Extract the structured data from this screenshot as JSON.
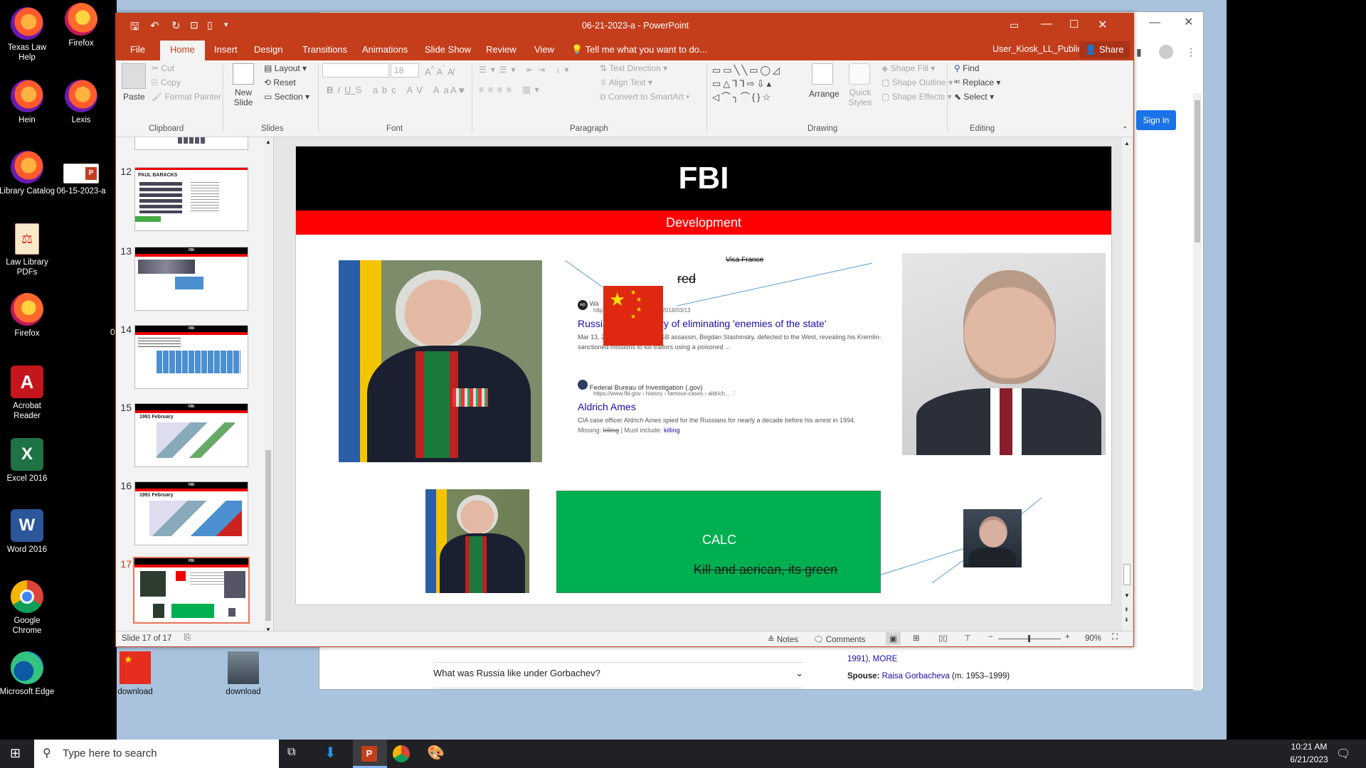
{
  "desktop": {
    "icons": [
      {
        "label": "Texas Law Help",
        "kind": "firefox-icon"
      },
      {
        "label": "Firefox",
        "kind": "firefox-icon"
      },
      {
        "label": "Hein",
        "kind": "firefox-icon"
      },
      {
        "label": "Lexis",
        "kind": "firefox-icon"
      },
      {
        "label": "Library Catalog",
        "kind": "firefox-icon"
      },
      {
        "label": "06-15-2023-a",
        "kind": "pptx-file-icon"
      },
      {
        "label": "Law Library PDFs",
        "kind": "pdf-folder-icon"
      },
      {
        "label": "Firefox",
        "kind": "firefox-icon"
      },
      {
        "label": "Acrobat Reader",
        "kind": "acrobat-icon"
      },
      {
        "label": "Excel 2016",
        "kind": "excel-icon"
      },
      {
        "label": "Word 2016",
        "kind": "word-icon"
      },
      {
        "label": "Google Chrome",
        "kind": "chrome-icon"
      },
      {
        "label": "Microsoft Edge",
        "kind": "edge-icon"
      },
      {
        "label": "download",
        "kind": "china-flag-thumbnail"
      },
      {
        "label": "download",
        "kind": "portrait-thumbnail"
      }
    ],
    "stray_char": "0"
  },
  "browser": {
    "sign_in": "Sign in",
    "faq_question": "What was Russia like under Gorbachev?",
    "kp_line1": "1991), MORE",
    "kp_spouse_label": "Spouse:",
    "kp_spouse_value": "Raisa Gorbacheva",
    "kp_spouse_years": "(m. 1953–1999)"
  },
  "ppt": {
    "window_title": "06-21-2023-a - PowerPoint",
    "tell_me": "Tell me what you want to do...",
    "user": "User_Kiosk_LL_Public",
    "share": "Share",
    "tabs": [
      "File",
      "Home",
      "Insert",
      "Design",
      "Transitions",
      "Animations",
      "Slide Show",
      "Review",
      "View"
    ],
    "active_tab": "Home",
    "ribbon": {
      "clipboard": {
        "paste": "Paste",
        "cut": "Cut",
        "copy": "Copy",
        "format_painter": "Format Painter",
        "group": "Clipboard"
      },
      "slides": {
        "new_slide": "New Slide",
        "layout": "Layout",
        "reset": "Reset",
        "section": "Section",
        "group": "Slides"
      },
      "font": {
        "font_size": "18",
        "group": "Font"
      },
      "paragraph": {
        "text_direction": "Text Direction",
        "align_text": "Align Text",
        "convert_smartart": "Convert to SmartArt",
        "group": "Paragraph"
      },
      "drawing": {
        "arrange": "Arrange",
        "quick_styles": "Quick Styles",
        "shape_fill": "Shape Fill",
        "shape_outline": "Shape Outline",
        "shape_effects": "Shape Effects",
        "group": "Drawing"
      },
      "editing": {
        "find": "Find",
        "replace": "Replace",
        "select": "Select",
        "group": "Editing"
      }
    },
    "thumbnails": [
      {
        "num": "12",
        "title": "PAUL BARACKS"
      },
      {
        "num": "13",
        "title": "FBI"
      },
      {
        "num": "14",
        "title": "FBI"
      },
      {
        "num": "15",
        "title": "1991 February"
      },
      {
        "num": "16",
        "title": "1991 February"
      },
      {
        "num": "17",
        "title": "FBI"
      }
    ],
    "status": {
      "slide_of": "Slide 17 of 17",
      "notes": "Notes",
      "comments": "Comments",
      "zoom": "90%"
    }
  },
  "slide": {
    "title": "FBI",
    "subtitle": "Development",
    "visa_text": "Visa France",
    "red_text": "red",
    "result1": {
      "source_prefix": "Wa",
      "url": "https · ...post.com › news › 2018/03/13",
      "title_a": "Russia",
      "title_b": "history of eliminating 'enemies of the state'",
      "snippet": "Mar 13, 2018 — In 1961, a KGB assassin, Bogdan Stashinsky, defected to the West, revealing his Kremlin-sanctioned missions to kill traitors using a poisoned ..."
    },
    "result2": {
      "source": "Federal Bureau of Investigation (.gov)",
      "url": "https://www.fbi.gov › history › famous-cases › aldrich...",
      "title": "Aldrich Ames",
      "snippet": "CIA case officer Aldrich Ames spied for the Russians for nearly a decade before his arrest in 1994.",
      "missing_label": "Missing:",
      "missing_word": "killing",
      "must_include_label": "| Must include:",
      "must_include_word": "killing"
    },
    "green_box": {
      "title": "CALC",
      "caption": "Kill and aerican, its green"
    }
  },
  "taskbar": {
    "search_placeholder": "Type here to search",
    "time": "10:21 AM",
    "date": "6/21/2023"
  },
  "colors": {
    "ppt_accent": "#c43e1c",
    "slide_red": "#ff0000",
    "slide_green": "#00b050",
    "taskbar": "#1f2125"
  }
}
